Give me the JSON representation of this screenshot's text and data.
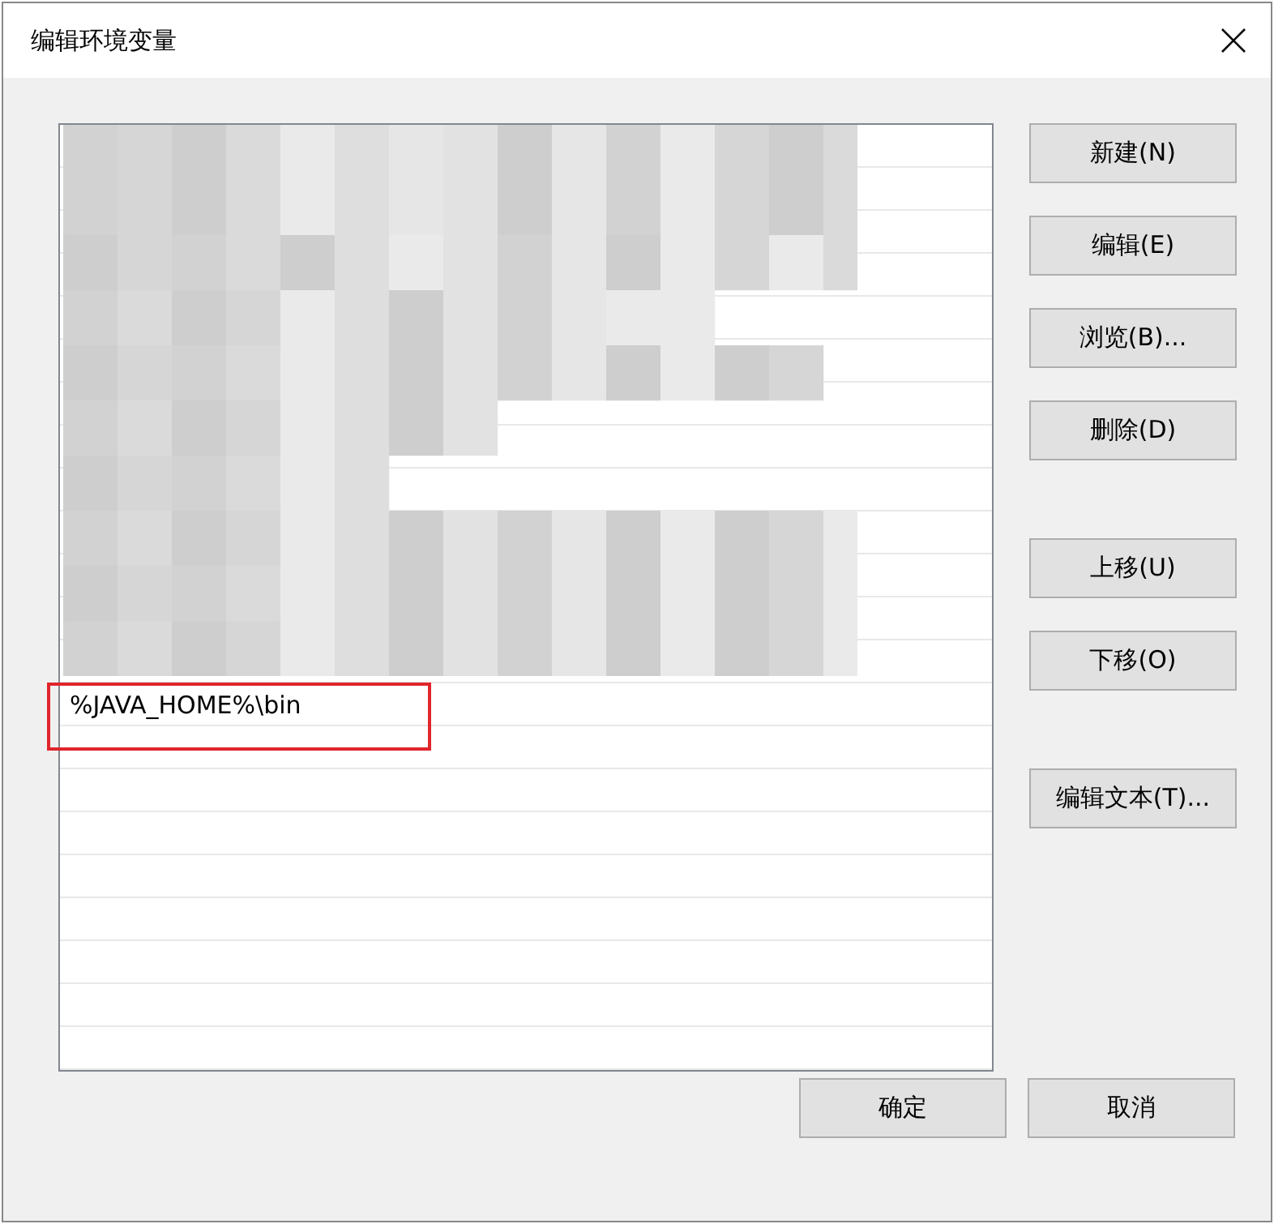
{
  "window": {
    "title": "编辑环境变量"
  },
  "list": {
    "entries": [
      {
        "text": "%JAVA_HOME%\\bin",
        "annotated": true
      }
    ]
  },
  "side_buttons": [
    [
      "新建(N)",
      "编辑(E)",
      "浏览(B)...",
      "删除(D)"
    ],
    [
      "上移(U)",
      "下移(O)"
    ],
    [
      "编辑文本(T)..."
    ]
  ],
  "footer_buttons": [
    "确定",
    "取消"
  ]
}
